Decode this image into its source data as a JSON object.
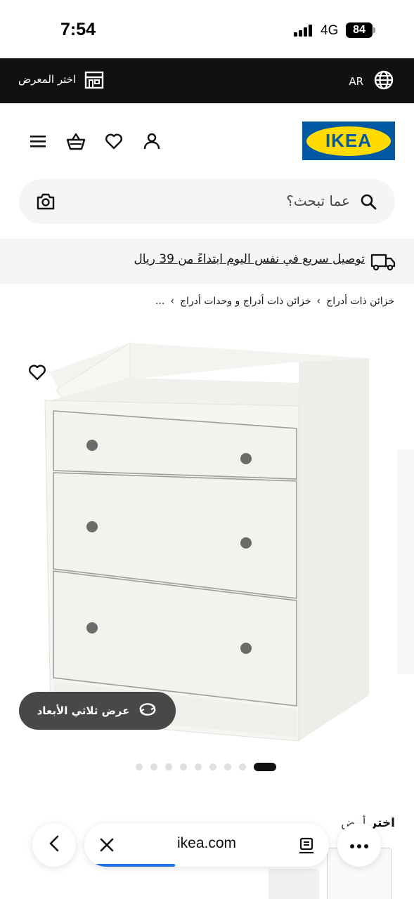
{
  "status_bar": {
    "time": "7:54",
    "network": "4G",
    "battery": "84"
  },
  "top_bar": {
    "store_label": "اختر المعرض",
    "language": "AR"
  },
  "header": {
    "logo_text": "IKEA"
  },
  "search": {
    "placeholder": "عما تبحث؟"
  },
  "delivery": {
    "text": "توصيل سريع في نفس اليوم ابتداءً من 39 ريال"
  },
  "breadcrumb": {
    "items": [
      "...",
      "خزائن ذات أدراج و وحدات أدراج",
      "خزائن ذات أدراج"
    ],
    "separator": "›"
  },
  "product": {
    "view3d_label": "عرض ثلاثي الأبعاد",
    "image_count": 9,
    "active_image": 9
  },
  "choose_color": {
    "label": "اختر",
    "value": "أبيض"
  },
  "browser": {
    "url": "ikea.com",
    "load_progress": 0.36
  },
  "colors": {
    "brand_blue": "#0058a3",
    "brand_yellow": "#ffdb00",
    "top_bar": "#111111",
    "progress": "#1a73e8"
  },
  "icons": [
    "store-icon",
    "globe-icon",
    "menu-icon",
    "basket-icon",
    "heart-icon",
    "user-icon",
    "camera-icon",
    "search-icon",
    "truck-icon",
    "rotate-3d-icon",
    "back-icon",
    "close-icon",
    "reader-icon",
    "more-icon"
  ]
}
